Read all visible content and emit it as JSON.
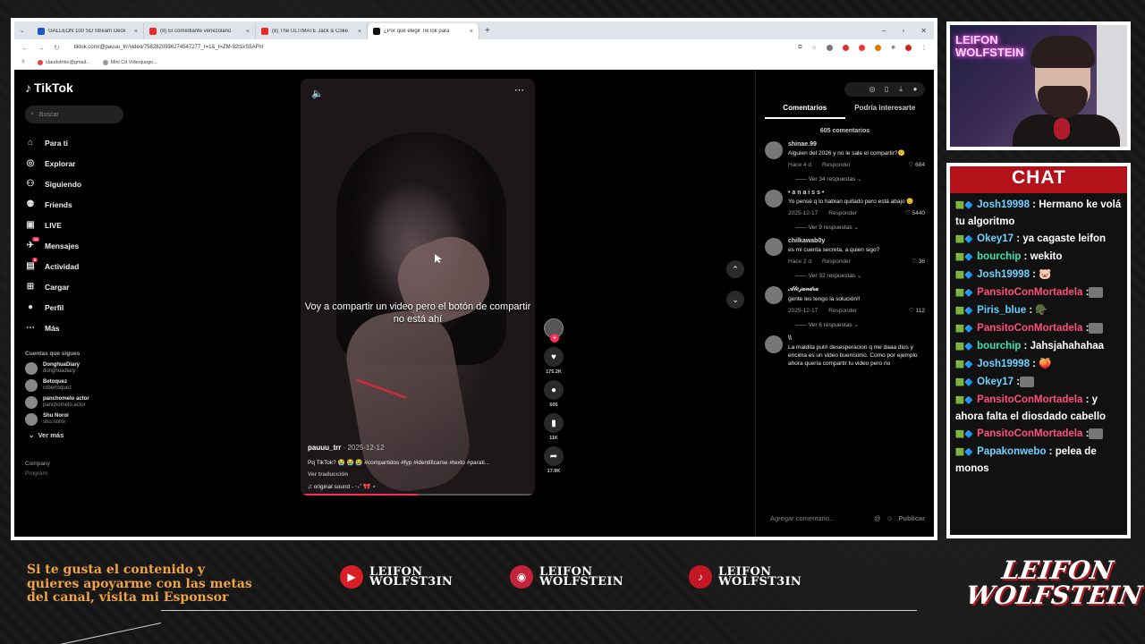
{
  "browser": {
    "tabs": [
      {
        "label": "GALLEON 100 SD Stream Deck",
        "color": "#1a56c8",
        "active": false
      },
      {
        "label": "(8) El comediante venezolano",
        "color": "#e52d27",
        "active": false
      },
      {
        "label": "(8) The ULTIMATE Jack & Coke",
        "color": "#e52d27",
        "active": false
      },
      {
        "label": "¿Por qué elegir TikTok para",
        "color": "#111111",
        "active": true
      }
    ],
    "url": "tiktok.com/@pauuu_trr/video/7582820936274547277_r=1&_t=ZM-92t1kS5AFhl",
    "bookmarks": [
      "claudstrike@gmail...",
      "Mini Cd Videojuego..."
    ]
  },
  "tiktok": {
    "logo": "TikTok",
    "search_placeholder": "Buscar",
    "nav": [
      {
        "icon": "home-icon",
        "glyph": "⌂",
        "label": "Para ti"
      },
      {
        "icon": "compass-icon",
        "glyph": "◎",
        "label": "Explorar"
      },
      {
        "icon": "following-icon",
        "glyph": "⚇",
        "label": "Siguiendo"
      },
      {
        "icon": "friends-icon",
        "glyph": "⚉",
        "label": "Friends"
      },
      {
        "icon": "live-icon",
        "glyph": "▣",
        "label": "LIVE"
      },
      {
        "icon": "messages-icon",
        "glyph": "✈",
        "label": "Mensajes",
        "badge": "19"
      },
      {
        "icon": "activity-icon",
        "glyph": "▤",
        "label": "Actividad",
        "badge": "8"
      },
      {
        "icon": "upload-icon",
        "glyph": "⊞",
        "label": "Cargar"
      },
      {
        "icon": "profile-icon",
        "glyph": "●",
        "label": "Perfil"
      },
      {
        "icon": "more-icon",
        "glyph": "⋯",
        "label": "Más"
      }
    ],
    "following_title": "Cuentas que sigues",
    "following": [
      {
        "name": "DonghuaDiary",
        "handle": "donghuadiary"
      },
      {
        "name": "Betoquez",
        "handle": "robertoquez"
      },
      {
        "name": "panchomelo actor",
        "handle": "panchomelo.actor"
      },
      {
        "name": "Shu Noroi",
        "handle": "shu.noroi"
      }
    ],
    "see_more": "Ver más",
    "company": "Company",
    "program": "Program",
    "video": {
      "caption": "Voy a compartir un video pero el botón de compartir no está ahí",
      "author": "pauuu_trr",
      "date": "· 2025-12-12",
      "description": "Pq TikTok? 😭 😭 😭 #compartidos #fyp #identificarse #texto #parati...",
      "translate": "Ver traducción",
      "sound": "♫ original sound - ‧₊˚ 🎀 ⋆",
      "progress": 0.5
    },
    "actions": [
      {
        "icon": "heart-icon",
        "glyph": "♥",
        "count": "175.2K"
      },
      {
        "icon": "comment-icon",
        "glyph": "●",
        "count": "605"
      },
      {
        "icon": "bookmark-icon",
        "glyph": "▮",
        "count": "11K"
      },
      {
        "icon": "share-icon",
        "glyph": "➦",
        "count": "17.9K"
      }
    ],
    "comments_panel": {
      "tabs": [
        "Comentarios",
        "Podría interesarte"
      ],
      "count": "605 comentarios",
      "comments": [
        {
          "user": "shinae.99",
          "text": "Alguien del 2026 y no le sale el compartir?😕",
          "time": "Hace 4 d",
          "reply": "Responder",
          "likes": "684",
          "replies": "Ver 34 respuestas ⌄"
        },
        {
          "user": "• a n a i s s •",
          "text": "Yo pensé q lo habían quitado pero está abajo 😊",
          "time": "2025-12-17",
          "reply": "Responder",
          "likes": "5440",
          "replies": "Ver 9 respuestas ⌄"
        },
        {
          "user": "chilkawab0y",
          "text": "es mi cuenta secreta, a quien sigo?",
          "time": "Hace 2 d",
          "reply": "Responder",
          "likes": "36",
          "replies": "Ver 32 respuestas ⌄"
        },
        {
          "user": "𝒜𝓁𝑒𝒿𝒶𝓃𝒹𝓇𝒶",
          "text": "gente les tengo la solución!!",
          "time": "2025-12-17",
          "reply": "Responder",
          "likes": "112",
          "replies": "Ver 6 respuestas ⌄"
        },
        {
          "user": "\\\\",
          "text": "La maldita put# desesperacion q me daaa dios y encima es un video buenísimo. Como por ejemplo ahora quería compartir tu video pero no",
          "time": "",
          "reply": "",
          "likes": "",
          "replies": ""
        }
      ],
      "add_placeholder": "Agregar comentario...",
      "publish": "Publicar"
    }
  },
  "stream": {
    "neon_sign": "LEIFON WOLFSTEIN",
    "chat_title": "CHAT",
    "chat": [
      {
        "user": "Josh19998",
        "color": "#6fd3ff",
        "text": ": Hermano ke volá tu algoritmo"
      },
      {
        "user": "Okey17",
        "color": "#6fd3ff",
        "text": ": ya cagaste leifon"
      },
      {
        "user": "bourchip",
        "color": "#3be3a8",
        "text": ": wekito"
      },
      {
        "user": "Josh19998",
        "color": "#6fd3ff",
        "text": ": 🐷"
      },
      {
        "user": "PansitoConMortadela",
        "color": "#ff4f7e",
        "text": ":"
      },
      {
        "user": "Piris_blue",
        "color": "#5fd1ff",
        "text": ": 🪖"
      },
      {
        "user": "PansitoConMortadela",
        "color": "#ff4f7e",
        "text": ":"
      },
      {
        "user": "bourchip",
        "color": "#3be3a8",
        "text": ": Jahsjahahahaa"
      },
      {
        "user": "Josh19998",
        "color": "#6fd3ff",
        "text": ": 🍑"
      },
      {
        "user": "Okey17",
        "color": "#6fd3ff",
        "text": ":"
      },
      {
        "user": "PansitoConMortadela",
        "color": "#ff4f7e",
        "text": ": y ahora falta el diosdado cabello"
      },
      {
        "user": "PansitoConMortadela",
        "color": "#ff4f7e",
        "text": ":"
      },
      {
        "user": "Papakonwebo",
        "color": "#6fd3ff",
        "text": ": pelea de monos"
      }
    ],
    "promo": "Si te gusta el contenido y quieres apoyarme con las metas del canal, visita mi Esponsor",
    "socials": [
      {
        "icon": "youtube-icon",
        "glyph": "▶",
        "label": "LEIFON WOLFST3IN",
        "x": 0
      },
      {
        "icon": "instagram-icon",
        "glyph": "◉",
        "label": "LEIFON WOLFSTEIN",
        "x": 1
      },
      {
        "icon": "tiktok-icon",
        "glyph": "♪",
        "label": "LEIFON WOLFST3IN",
        "x": 2
      }
    ],
    "brand": "LEIFON WOLFSTEIN"
  }
}
